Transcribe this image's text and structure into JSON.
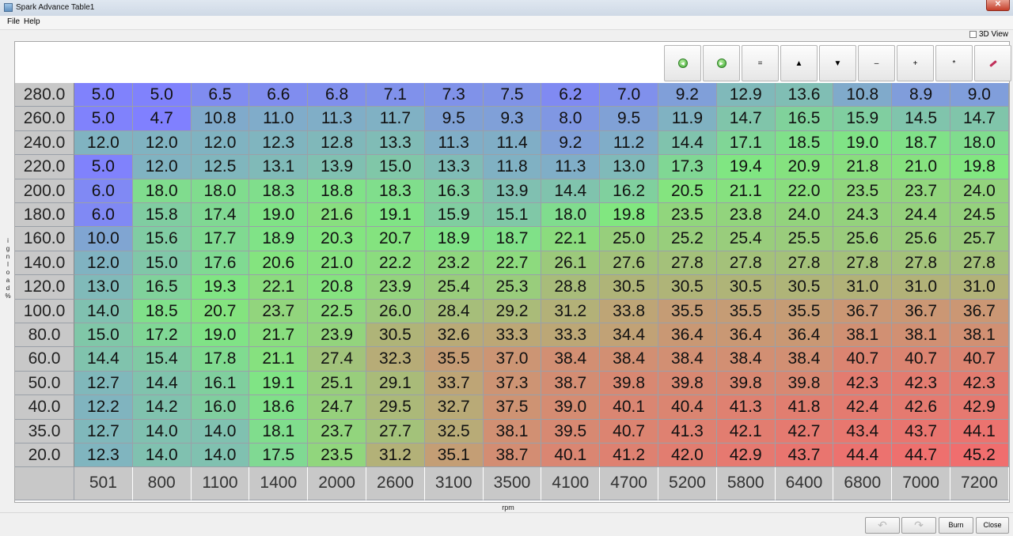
{
  "window": {
    "title": "Spark Advance Table1",
    "close_glyph": "✕"
  },
  "menu": [
    {
      "label": "File"
    },
    {
      "label": "Help"
    }
  ],
  "view3d_label": "3D View",
  "toolbar": [
    {
      "name": "revert-icon",
      "glyph": "◂"
    },
    {
      "name": "apply-icon",
      "glyph": "▸"
    },
    {
      "name": "equals-button",
      "glyph": "="
    },
    {
      "name": "increment-button",
      "glyph": "▲"
    },
    {
      "name": "decrement-button",
      "glyph": "▼"
    },
    {
      "name": "subtract-button",
      "glyph": "–"
    },
    {
      "name": "add-button",
      "glyph": "+"
    },
    {
      "name": "multiply-button",
      "glyph": "*"
    },
    {
      "name": "pencil-icon",
      "glyph": ""
    }
  ],
  "y_axis": {
    "label": "ignload%",
    "values": [
      "280.0",
      "260.0",
      "240.0",
      "220.0",
      "200.0",
      "180.0",
      "160.0",
      "140.0",
      "120.0",
      "100.0",
      "80.0",
      "60.0",
      "50.0",
      "40.0",
      "35.0",
      "20.0"
    ]
  },
  "x_axis": {
    "label": "rpm",
    "values": [
      "501",
      "800",
      "1100",
      "1400",
      "2000",
      "2600",
      "3100",
      "3500",
      "4100",
      "4700",
      "5200",
      "5800",
      "6400",
      "6800",
      "7000",
      "7200"
    ]
  },
  "table": [
    [
      "5.0",
      "5.0",
      "6.5",
      "6.6",
      "6.8",
      "7.1",
      "7.3",
      "7.5",
      "6.2",
      "7.0",
      "9.2",
      "12.9",
      "13.6",
      "10.8",
      "8.9",
      "9.0"
    ],
    [
      "5.0",
      "4.7",
      "10.8",
      "11.0",
      "11.3",
      "11.7",
      "9.5",
      "9.3",
      "8.0",
      "9.5",
      "11.9",
      "14.7",
      "16.5",
      "15.9",
      "14.5",
      "14.7"
    ],
    [
      "12.0",
      "12.0",
      "12.0",
      "12.3",
      "12.8",
      "13.3",
      "11.3",
      "11.4",
      "9.2",
      "11.2",
      "14.4",
      "17.1",
      "18.5",
      "19.0",
      "18.7",
      "18.0"
    ],
    [
      "5.0",
      "12.0",
      "12.5",
      "13.1",
      "13.9",
      "15.0",
      "13.3",
      "11.8",
      "11.3",
      "13.0",
      "17.3",
      "19.4",
      "20.9",
      "21.8",
      "21.0",
      "19.8"
    ],
    [
      "6.0",
      "18.0",
      "18.0",
      "18.3",
      "18.8",
      "18.3",
      "16.3",
      "13.9",
      "14.4",
      "16.2",
      "20.5",
      "21.1",
      "22.0",
      "23.5",
      "23.7",
      "24.0"
    ],
    [
      "6.0",
      "15.8",
      "17.4",
      "19.0",
      "21.6",
      "19.1",
      "15.9",
      "15.1",
      "18.0",
      "19.8",
      "23.5",
      "23.8",
      "24.0",
      "24.3",
      "24.4",
      "24.5"
    ],
    [
      "10.0",
      "15.6",
      "17.7",
      "18.9",
      "20.3",
      "20.7",
      "18.9",
      "18.7",
      "22.1",
      "25.0",
      "25.2",
      "25.4",
      "25.5",
      "25.6",
      "25.6",
      "25.7"
    ],
    [
      "12.0",
      "15.0",
      "17.6",
      "20.6",
      "21.0",
      "22.2",
      "23.2",
      "22.7",
      "26.1",
      "27.6",
      "27.8",
      "27.8",
      "27.8",
      "27.8",
      "27.8",
      "27.8"
    ],
    [
      "13.0",
      "16.5",
      "19.3",
      "22.1",
      "20.8",
      "23.9",
      "25.4",
      "25.3",
      "28.8",
      "30.5",
      "30.5",
      "30.5",
      "30.5",
      "31.0",
      "31.0",
      "31.0"
    ],
    [
      "14.0",
      "18.5",
      "20.7",
      "23.7",
      "22.5",
      "26.0",
      "28.4",
      "29.2",
      "31.2",
      "33.8",
      "35.5",
      "35.5",
      "35.5",
      "36.7",
      "36.7",
      "36.7"
    ],
    [
      "15.0",
      "17.2",
      "19.0",
      "21.7",
      "23.9",
      "30.5",
      "32.6",
      "33.3",
      "33.3",
      "34.4",
      "36.4",
      "36.4",
      "36.4",
      "38.1",
      "38.1",
      "38.1"
    ],
    [
      "14.4",
      "15.4",
      "17.8",
      "21.1",
      "27.4",
      "32.3",
      "35.5",
      "37.0",
      "38.4",
      "38.4",
      "38.4",
      "38.4",
      "38.4",
      "40.7",
      "40.7",
      "40.7"
    ],
    [
      "12.7",
      "14.4",
      "16.1",
      "19.1",
      "25.1",
      "29.1",
      "33.7",
      "37.3",
      "38.7",
      "39.8",
      "39.8",
      "39.8",
      "39.8",
      "42.3",
      "42.3",
      "42.3"
    ],
    [
      "12.2",
      "14.2",
      "16.0",
      "18.6",
      "24.7",
      "29.5",
      "32.7",
      "37.5",
      "39.0",
      "40.1",
      "40.4",
      "41.3",
      "41.8",
      "42.4",
      "42.6",
      "42.9"
    ],
    [
      "12.7",
      "14.0",
      "14.0",
      "18.1",
      "23.7",
      "27.7",
      "32.5",
      "38.1",
      "39.5",
      "40.7",
      "41.3",
      "42.1",
      "42.7",
      "43.4",
      "43.7",
      "44.1"
    ],
    [
      "12.3",
      "14.0",
      "14.0",
      "17.5",
      "23.5",
      "31.2",
      "35.1",
      "38.7",
      "40.1",
      "41.2",
      "42.0",
      "42.9",
      "43.7",
      "44.4",
      "44.7",
      "45.2"
    ]
  ],
  "bottom": {
    "undo_glyph": "↶",
    "redo_glyph": "↷",
    "burn_label": "Burn",
    "close_label": "Close"
  }
}
